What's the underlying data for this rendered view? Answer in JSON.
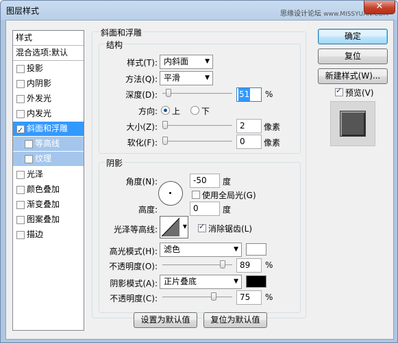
{
  "window": {
    "title": "图层样式",
    "watermark": "思缘设计论坛",
    "watermark_url": "www.MISSYUAN.COM",
    "close_glyph": "✕"
  },
  "sidebar": {
    "header": "样式",
    "blend_options": "混合选项:默认",
    "items": [
      {
        "label": "投影",
        "checked": false
      },
      {
        "label": "内阴影",
        "checked": false
      },
      {
        "label": "外发光",
        "checked": false
      },
      {
        "label": "内发光",
        "checked": false
      },
      {
        "label": "斜面和浮雕",
        "checked": true
      },
      {
        "label": "等高线",
        "checked": false
      },
      {
        "label": "纹理",
        "checked": false
      },
      {
        "label": "光泽",
        "checked": false
      },
      {
        "label": "颜色叠加",
        "checked": false
      },
      {
        "label": "渐变叠加",
        "checked": false
      },
      {
        "label": "图案叠加",
        "checked": false
      },
      {
        "label": "描边",
        "checked": false
      }
    ]
  },
  "bevel": {
    "group_title": "斜面和浮雕",
    "structure_title": "结构",
    "style_label": "样式(T):",
    "style_value": "内斜面",
    "technique_label": "方法(Q):",
    "technique_value": "平滑",
    "depth_label": "深度(D):",
    "depth_value": "51",
    "depth_unit": "%",
    "depth_level": 0.05,
    "direction_label": "方向:",
    "direction_up": "上",
    "direction_down": "下",
    "size_label": "大小(Z):",
    "size_value": "2",
    "size_unit": "像素",
    "soften_label": "软化(F):",
    "soften_value": "0",
    "soften_unit": "像素"
  },
  "shading": {
    "title": "阴影",
    "angle_label": "角度(N):",
    "angle_value": "-50",
    "angle_unit": "度",
    "global_light_label": "使用全局光(G)",
    "global_light_checked": false,
    "altitude_label": "高度:",
    "altitude_value": "0",
    "altitude_unit": "度",
    "gloss_contour_label": "光泽等高线:",
    "anti_aliased_label": "消除锯齿(L)",
    "anti_aliased_checked": true,
    "highlight_mode_label": "高光模式(H):",
    "highlight_mode_value": "滤色",
    "highlight_color": "#ffffff",
    "highlight_opacity_label": "不透明度(O):",
    "highlight_opacity_value": "89",
    "highlight_opacity_unit": "%",
    "highlight_opacity_level": 0.89,
    "shadow_mode_label": "阴影模式(A):",
    "shadow_mode_value": "正片叠底",
    "shadow_color": "#000000",
    "shadow_opacity_label": "不透明度(C):",
    "shadow_opacity_value": "75",
    "shadow_opacity_unit": "%",
    "shadow_opacity_level": 0.75
  },
  "footer": {
    "make_default": "设置为默认值",
    "reset_default": "复位为默认值"
  },
  "actions": {
    "ok": "确定",
    "reset": "复位",
    "new_style": "新建样式(W)...",
    "preview_label": "预览(V)",
    "preview_checked": true
  },
  "colors": {
    "selection": "#3399ff",
    "preview_swatch": "#555555"
  }
}
